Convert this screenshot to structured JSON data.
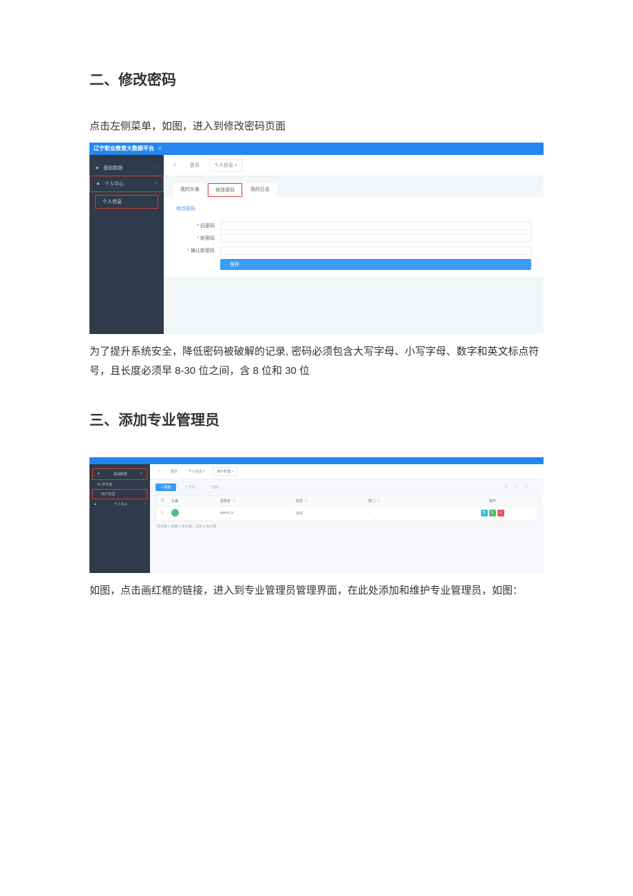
{
  "doc": {
    "heading1": "二、修改密码",
    "intro1": "点击左侧菜单，如图，进入到修改密码页面",
    "para1": "为了提升系统安全，降低密码被破解的记录, 密码必须包含大写字母、小写字母、数字和英文标点符号，且长度必须早 8-30 位之间，含 8 位和 30 位",
    "heading2": "三、添加专业管理员",
    "para2": "如图，点击画红框的链接，进入到专业管理员管理界面，在此处添加和维护专业管理员，如图："
  },
  "shot1": {
    "appTitle": "辽宁职业教育大数据平台",
    "sidebar": {
      "items": [
        {
          "icon": "★",
          "label": "基础数据"
        },
        {
          "icon": "▲",
          "label": "个人中心"
        }
      ],
      "sub": "个人信息"
    },
    "crumbs": {
      "back": "«",
      "home": "首页",
      "active": "个人信息 ×"
    },
    "tabs": {
      "avatar": "我的头像",
      "password": "修改密码",
      "log": "我的日志"
    },
    "panelTitle": "修改密码",
    "form": {
      "oldPwd": "旧密码",
      "newPwd": "新密码",
      "confirmPwd": "确认新密码",
      "save": "保存"
    }
  },
  "shot2": {
    "sidebar": {
      "items": [
        {
          "icon": "★",
          "label": "基础数据"
        }
      ],
      "subs": [
        "学年度",
        "用户管理"
      ],
      "item2": {
        "icon": "▲",
        "label": "个人中心"
      }
    },
    "crumbs": {
      "back": "«",
      "home": "首页",
      "c1": "个人信息 ×",
      "active": "用户管理 ×"
    },
    "toolbar": {
      "add": "+ 新建",
      "edit": "✎ 修改",
      "del": "× 删除",
      "icons": [
        "Q",
        "⟳",
        "⤢",
        "⋮"
      ]
    },
    "table": {
      "headers": {
        "avatar": "头像",
        "login": "登录名",
        "name": "姓名",
        "dept": "部门",
        "op": "操作"
      },
      "row": {
        "login": "admin_b",
        "name": "测试",
        "dept": "-"
      }
    },
    "pagination": "显示第 1 到第 1 条记录，总共 1 条记录"
  }
}
